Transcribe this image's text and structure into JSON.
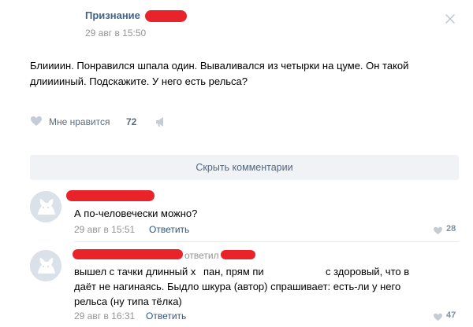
{
  "post": {
    "author": "Признание",
    "date": "29 авг в 15:50",
    "text_line1": "Блиииин. Понравился шпала один. Вываливался из четырки на цуме. Он такой",
    "text_line2": "длииииный. Подскажите. У него есть рельса?",
    "like_label": "Мне нравится",
    "like_count": "72"
  },
  "toggle_comments": {
    "label": "Скрыть комментарии"
  },
  "comments": [
    {
      "text": "А по-человечески можно?",
      "date": "29 авг в 15:51",
      "reply_label": "Ответить",
      "likes": "28"
    },
    {
      "header_label": "ответил",
      "text_line1": "вышел с тачки длинный х",
      "text_line1b": "пан, прям пи",
      "text_line1c": "с здоровый, что в",
      "text_line2": "даёт не нагинаясь. Быдло шкура (автор) спрашивает: есть-ли у него",
      "text_line3": "рельса (ну типа тёлка)",
      "date": "29 авг в 16:31",
      "reply_label": "Ответить",
      "likes": "47"
    }
  ],
  "colors": {
    "redaction": "#e8242a",
    "link": "#2a5885",
    "muted": "#939393"
  }
}
